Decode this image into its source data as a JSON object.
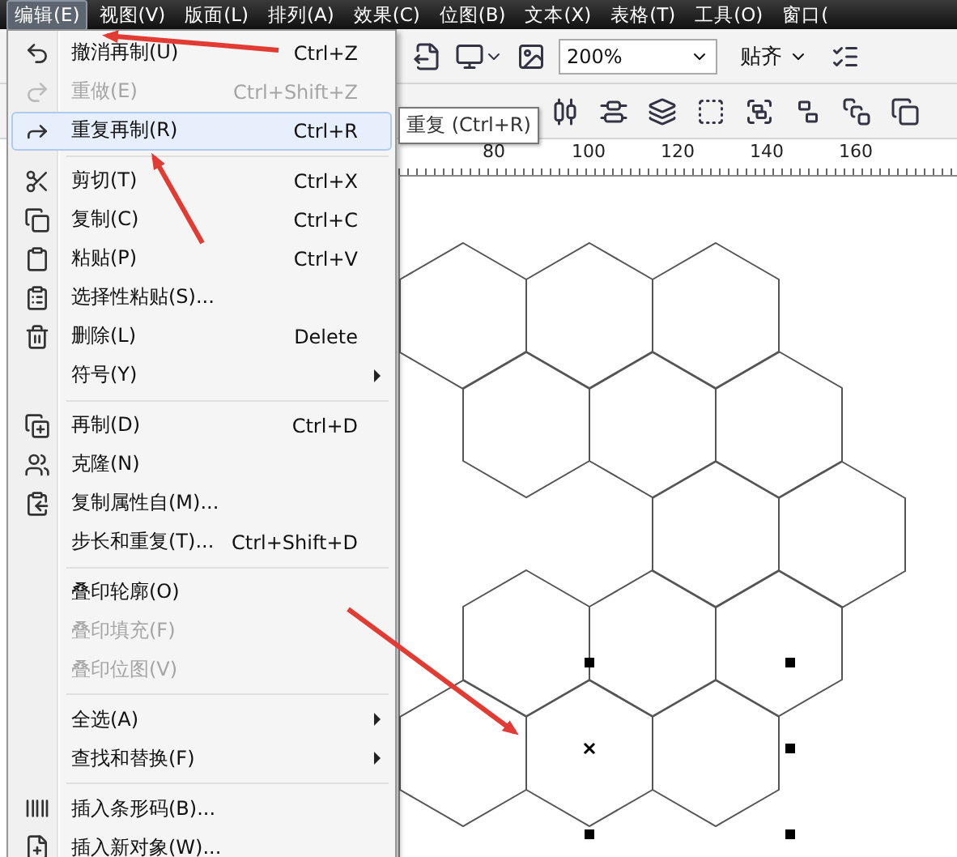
{
  "menubar": [
    {
      "label": "编辑(E)",
      "selected": true
    },
    {
      "label": "视图(V)",
      "selected": false
    },
    {
      "label": "版面(L)",
      "selected": false
    },
    {
      "label": "排列(A)",
      "selected": false
    },
    {
      "label": "效果(C)",
      "selected": false
    },
    {
      "label": "位图(B)",
      "selected": false
    },
    {
      "label": "文本(X)",
      "selected": false
    },
    {
      "label": "表格(T)",
      "selected": false
    },
    {
      "label": "工具(O)",
      "selected": false
    },
    {
      "label": "窗口(",
      "selected": false
    }
  ],
  "edit_menu": {
    "groups": [
      [
        {
          "label": "撤消再制(U)",
          "shortcut": "Ctrl+Z",
          "disabled": false,
          "selected": false,
          "submenu": false
        },
        {
          "label": "重做(E)",
          "shortcut": "Ctrl+Shift+Z",
          "disabled": true,
          "selected": false,
          "submenu": false
        },
        {
          "label": "重复再制(R)",
          "shortcut": "Ctrl+R",
          "disabled": false,
          "selected": true,
          "submenu": false
        }
      ],
      [
        {
          "label": "剪切(T)",
          "shortcut": "Ctrl+X",
          "disabled": false,
          "selected": false,
          "submenu": false
        },
        {
          "label": "复制(C)",
          "shortcut": "Ctrl+C",
          "disabled": false,
          "selected": false,
          "submenu": false
        },
        {
          "label": "粘贴(P)",
          "shortcut": "Ctrl+V",
          "disabled": false,
          "selected": false,
          "submenu": false
        },
        {
          "label": "选择性粘贴(S)...",
          "disabled": false,
          "selected": false,
          "submenu": false
        },
        {
          "label": "删除(L)",
          "shortcut": "Delete",
          "disabled": false,
          "selected": false,
          "submenu": false
        },
        {
          "label": "符号(Y)",
          "disabled": false,
          "selected": false,
          "submenu": true
        }
      ],
      [
        {
          "label": "再制(D)",
          "shortcut": "Ctrl+D",
          "disabled": false,
          "selected": false,
          "submenu": false
        },
        {
          "label": "克隆(N)",
          "disabled": false,
          "selected": false,
          "submenu": false
        },
        {
          "label": "复制属性自(M)...",
          "disabled": false,
          "selected": false,
          "submenu": false
        },
        {
          "label": "步长和重复(T)...",
          "shortcut": "Ctrl+Shift+D",
          "disabled": false,
          "selected": false,
          "submenu": false
        }
      ],
      [
        {
          "label": "叠印轮廓(O)",
          "disabled": false,
          "selected": false,
          "submenu": false
        },
        {
          "label": "叠印填充(F)",
          "disabled": true,
          "selected": false,
          "submenu": false
        },
        {
          "label": "叠印位图(V)",
          "disabled": true,
          "selected": false,
          "submenu": false
        }
      ],
      [
        {
          "label": "全选(A)",
          "disabled": false,
          "selected": false,
          "submenu": true
        },
        {
          "label": "查找和替换(F)",
          "disabled": false,
          "selected": false,
          "submenu": true
        }
      ],
      [
        {
          "label": "插入条形码(B)...",
          "disabled": false,
          "selected": false,
          "submenu": false
        },
        {
          "label": "插入新对象(W)...",
          "disabled": false,
          "selected": false,
          "submenu": false
        }
      ]
    ]
  },
  "tooltip": "重复 (Ctrl+R)",
  "toolbar": {
    "zoom": "200%",
    "snap": "贴齐"
  },
  "ruler": [
    "80",
    "100",
    "120",
    "140",
    "160"
  ]
}
